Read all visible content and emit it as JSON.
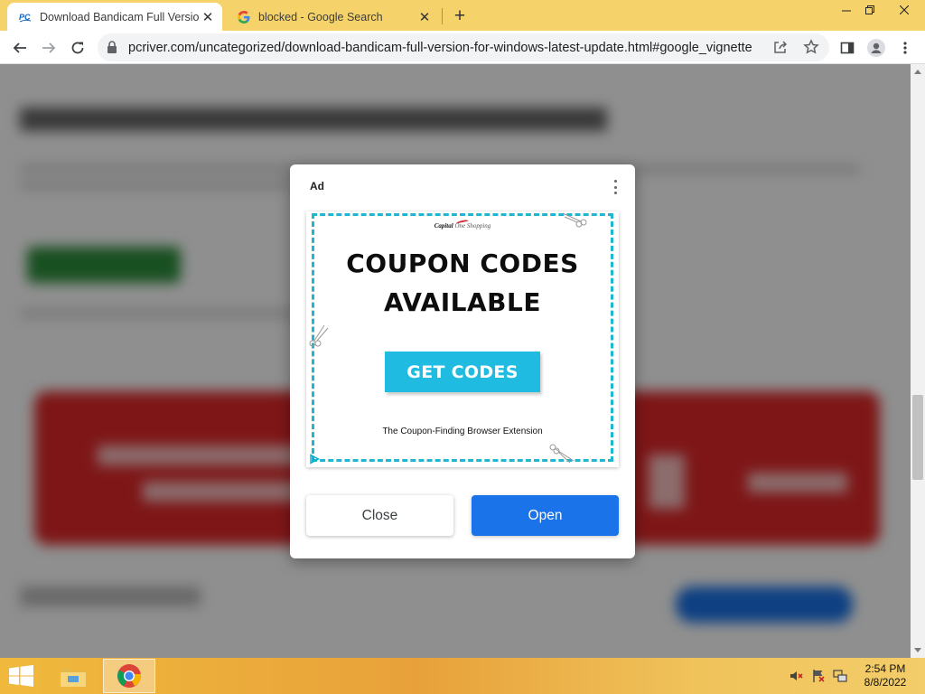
{
  "browser": {
    "tabs": [
      {
        "title": "Download Bandicam Full Version",
        "active": true,
        "favicon": "pc-favicon"
      },
      {
        "title": "blocked - Google Search",
        "active": false,
        "favicon": "google-g-icon"
      }
    ],
    "new_tab_icon": "plus-icon",
    "window_controls": [
      "minimize-icon",
      "restore-icon",
      "close-icon"
    ],
    "url": "pcriver.com/uncategorized/download-bandicam-full-version-for-windows-latest-update.html#google_vignette"
  },
  "ad_dialog": {
    "label": "Ad",
    "creative": {
      "brand_name": "Capital",
      "brand_suffix": "One Shopping",
      "headline": "COUPON CODES AVAILABLE",
      "cta": "GET CODES",
      "tagline": "The Coupon-Finding Browser Extension",
      "accent_color": "#1fb6d2"
    },
    "close_label": "Close",
    "open_label": "Open",
    "open_color": "#1a73e8"
  },
  "taskbar": {
    "apps": [
      "file-explorer-icon",
      "chrome-icon"
    ],
    "tray": [
      "volume-muted-icon",
      "flag-icon",
      "network-icon"
    ],
    "time": "2:54 PM",
    "date": "8/8/2022"
  }
}
